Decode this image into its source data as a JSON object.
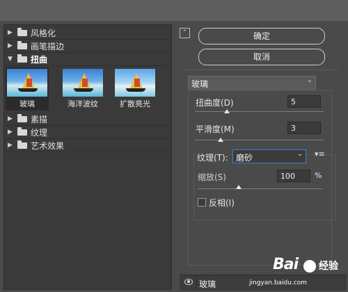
{
  "categories": {
    "c1": "风格化",
    "c2": "画笔描边",
    "c3": "扭曲",
    "c4": "素描",
    "c5": "纹理",
    "c6": "艺术效果"
  },
  "thumbnails": {
    "t1": "玻璃",
    "t2": "海洋波纹",
    "t3": "扩散亮光"
  },
  "buttons": {
    "ok": "确定",
    "cancel": "取消"
  },
  "filter_select": {
    "value": "玻璃"
  },
  "distortion": {
    "label": "扭曲度(D)",
    "value": "5",
    "max": 20
  },
  "smoothness": {
    "label": "平滑度(M)",
    "value": "3",
    "max": 15
  },
  "texture": {
    "label": "纹理(T):",
    "value": "磨砂"
  },
  "scaling": {
    "label": "缩放(S)",
    "value": "100",
    "unit": "%"
  },
  "invert": {
    "label": "反相(I)",
    "checked": false
  },
  "layer": {
    "name": "玻璃"
  },
  "watermark": {
    "logo": "Bai",
    "brand": "经验",
    "url": "jingyan.baidu.com"
  },
  "colors": {
    "panel_bg": "#4a4a4a",
    "list_bg": "#3a3a3a",
    "focus": "#3c7fd6"
  }
}
